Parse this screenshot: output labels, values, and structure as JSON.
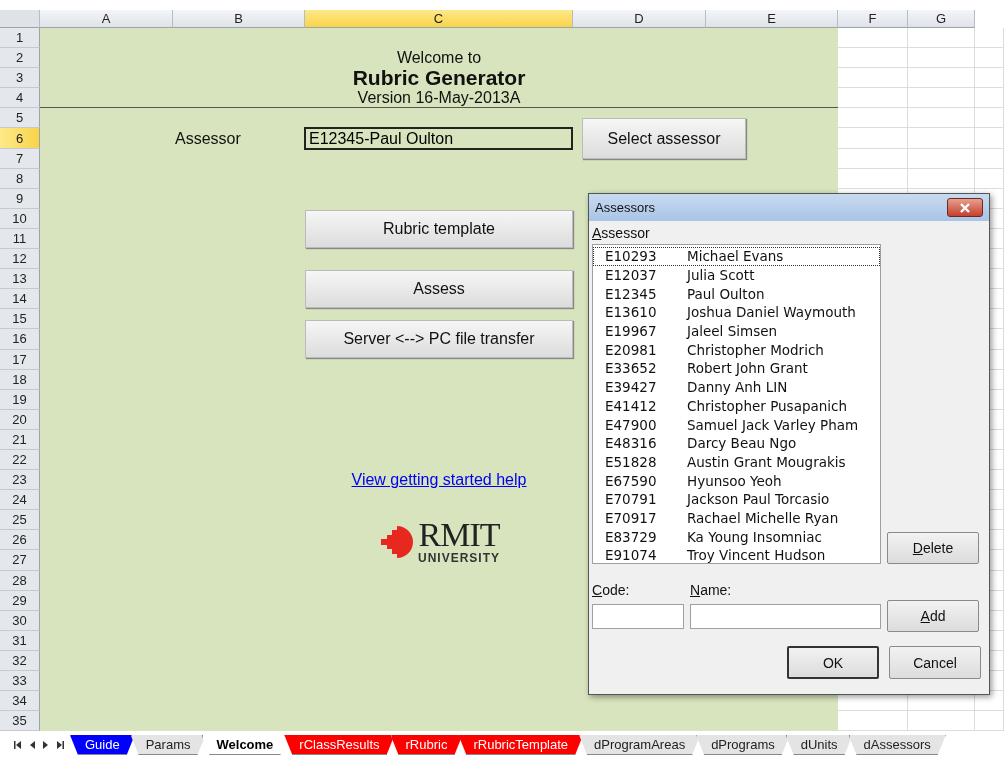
{
  "columns": [
    {
      "label": "A",
      "selected": false
    },
    {
      "label": "B",
      "selected": false
    },
    {
      "label": "C",
      "selected": true
    },
    {
      "label": "D",
      "selected": false
    },
    {
      "label": "E",
      "selected": false
    },
    {
      "label": "F",
      "selected": false
    },
    {
      "label": "G",
      "selected": false
    }
  ],
  "rows": [
    {
      "label": "1",
      "selected": false
    },
    {
      "label": "2",
      "selected": false
    },
    {
      "label": "3",
      "selected": false
    },
    {
      "label": "4",
      "selected": false
    },
    {
      "label": "5",
      "selected": false
    },
    {
      "label": "6",
      "selected": true
    },
    {
      "label": "7",
      "selected": false
    },
    {
      "label": "8",
      "selected": false
    },
    {
      "label": "9",
      "selected": false
    },
    {
      "label": "10",
      "selected": false
    },
    {
      "label": "11",
      "selected": false
    },
    {
      "label": "12",
      "selected": false
    },
    {
      "label": "13",
      "selected": false
    },
    {
      "label": "14",
      "selected": false
    },
    {
      "label": "15",
      "selected": false
    },
    {
      "label": "16",
      "selected": false
    },
    {
      "label": "17",
      "selected": false
    },
    {
      "label": "18",
      "selected": false
    },
    {
      "label": "19",
      "selected": false
    },
    {
      "label": "20",
      "selected": false
    },
    {
      "label": "21",
      "selected": false
    },
    {
      "label": "22",
      "selected": false
    },
    {
      "label": "23",
      "selected": false
    },
    {
      "label": "24",
      "selected": false
    },
    {
      "label": "25",
      "selected": false
    },
    {
      "label": "26",
      "selected": false
    },
    {
      "label": "27",
      "selected": false
    },
    {
      "label": "28",
      "selected": false
    },
    {
      "label": "29",
      "selected": false
    },
    {
      "label": "30",
      "selected": false
    },
    {
      "label": "31",
      "selected": false
    },
    {
      "label": "32",
      "selected": false
    },
    {
      "label": "33",
      "selected": false
    },
    {
      "label": "34",
      "selected": false
    },
    {
      "label": "35",
      "selected": false
    }
  ],
  "welcome": {
    "intro": "Welcome to",
    "title": "Rubric Generator",
    "version": "Version 16-May-2013A"
  },
  "assessor": {
    "label": "Assessor",
    "value": "E12345-Paul Oulton",
    "select_button": "Select assessor"
  },
  "actions": [
    "Rubric template",
    "Assess",
    "Server <--> PC file transfer"
  ],
  "help_link": "View getting started help",
  "logo": {
    "name": "RMIT",
    "subtitle": "UNIVERSITY"
  },
  "dialog": {
    "title": "Assessors",
    "list_label": "Assessor",
    "items": [
      {
        "code": "E10293",
        "name": "Michael Evans",
        "focused": true
      },
      {
        "code": "E12037",
        "name": "Julia Scott",
        "focused": false
      },
      {
        "code": "E12345",
        "name": "Paul Oulton",
        "focused": false
      },
      {
        "code": "E13610",
        "name": "Joshua Daniel Waymouth",
        "focused": false
      },
      {
        "code": "E19967",
        "name": "Jaleel Simsen",
        "focused": false
      },
      {
        "code": "E20981",
        "name": "Christopher Modrich",
        "focused": false
      },
      {
        "code": "E33652",
        "name": "Robert John Grant",
        "focused": false
      },
      {
        "code": "E39427",
        "name": "Danny Anh LIN",
        "focused": false
      },
      {
        "code": "E41412",
        "name": "Christopher Pusapanich",
        "focused": false
      },
      {
        "code": "E47900",
        "name": "Samuel Jack Varley Pham",
        "focused": false
      },
      {
        "code": "E48316",
        "name": "Darcy Beau Ngo",
        "focused": false
      },
      {
        "code": "E51828",
        "name": "Austin Grant Mougrakis",
        "focused": false
      },
      {
        "code": "E67590",
        "name": "Hyunsoo Yeoh",
        "focused": false
      },
      {
        "code": "E70791",
        "name": "Jackson Paul Torcasio",
        "focused": false
      },
      {
        "code": "E70917",
        "name": "Rachael Michelle Ryan",
        "focused": false
      },
      {
        "code": "E83729",
        "name": "Ka Young Insomniac",
        "focused": false
      },
      {
        "code": "E91074",
        "name": "Troy Vincent Hudson",
        "focused": false
      }
    ],
    "delete_button": "Delete",
    "code_label": "Code:",
    "name_label": "Name:",
    "add_button": "Add",
    "ok_button": "OK",
    "cancel_button": "Cancel"
  },
  "sheet_tabs": [
    {
      "label": "Guide",
      "selected": false,
      "color": "#0000ff"
    },
    {
      "label": "Params",
      "selected": false,
      "color": "#e4e4e4"
    },
    {
      "label": "Welcome",
      "selected": true,
      "color": "#ffffff"
    },
    {
      "label": "rClassResults",
      "selected": false,
      "color": "#ff0000"
    },
    {
      "label": "rRubric",
      "selected": false,
      "color": "#ff0000"
    },
    {
      "label": "rRubricTemplate",
      "selected": false,
      "color": "#ff0000"
    },
    {
      "label": "dProgramAreas",
      "selected": false,
      "color": "#e4e4e4"
    },
    {
      "label": "dPrograms",
      "selected": false,
      "color": "#e4e4e4"
    },
    {
      "label": "dUnits",
      "selected": false,
      "color": "#e4e4e4"
    },
    {
      "label": "dAssessors",
      "selected": false,
      "color": "#e4e4e4"
    }
  ]
}
